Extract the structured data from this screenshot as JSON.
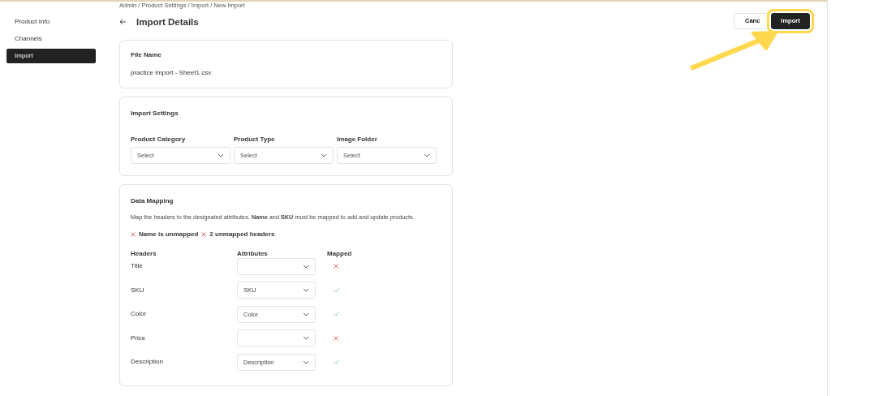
{
  "sidebar": {
    "items": [
      {
        "label": "Product Info",
        "selected": false
      },
      {
        "label": "Channels",
        "selected": false
      },
      {
        "label": "Import",
        "selected": true
      }
    ]
  },
  "breadcrumb": "Admin / Product Settings / Import / New Import",
  "page_title": "Import Details",
  "actions": [
    {
      "label": "Canc",
      "kind": "secondary",
      "highlighted": false
    },
    {
      "label": "Import",
      "kind": "primary",
      "highlighted": true
    }
  ],
  "file_card": {
    "title": "File Name",
    "value": "practice import - Sheet1.csv"
  },
  "settings_card": {
    "title": "Import Settings",
    "fields": [
      {
        "label": "Product Category",
        "placeholder": "Select"
      },
      {
        "label": "Product Type",
        "placeholder": "Select"
      },
      {
        "label": "Image Folder",
        "placeholder": "Select"
      }
    ]
  },
  "mapping_card": {
    "title": "Data Mapping",
    "description": "Map the headers to the designated attributes. **Name** and **SKU** must be mapped to add and update products.",
    "errors": [
      "Name is unmapped",
      "2 unmapped headers"
    ],
    "columns": [
      "Headers",
      "Attributes",
      "Mapped"
    ],
    "rows": [
      {
        "header": "Title",
        "attribute": "",
        "mapped": false
      },
      {
        "header": "SKU",
        "attribute": "SKU",
        "mapped": true
      },
      {
        "header": "Color",
        "attribute": "Color",
        "mapped": true
      },
      {
        "header": "Price",
        "attribute": "",
        "mapped": false
      },
      {
        "header": "Description",
        "attribute": "Description",
        "mapped": true
      }
    ]
  }
}
